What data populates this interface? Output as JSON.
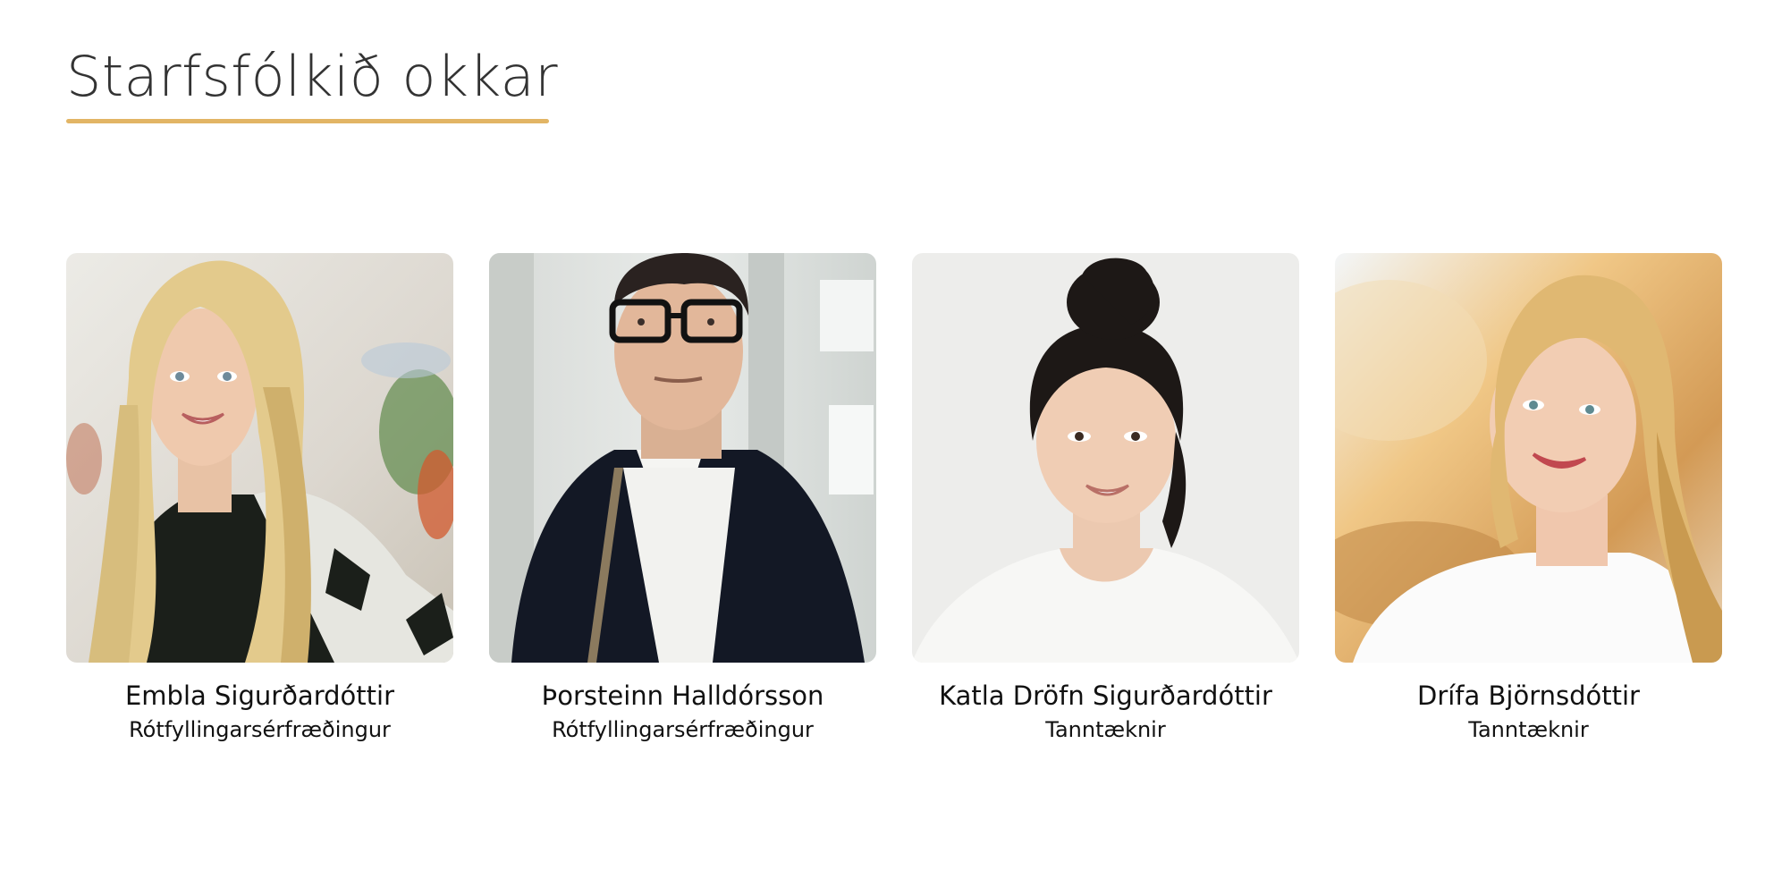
{
  "section": {
    "title": "Starfsfólkið okkar",
    "accent_color": "#E2B565"
  },
  "staff": [
    {
      "name": "Embla Sigurðardóttir",
      "role": "Rótfyllingarsérfræðingur",
      "photo_icon": "portrait-woman-blonde-icon"
    },
    {
      "name": "Þorsteinn Halldórsson",
      "role": "Rótfyllingarsérfræðingur",
      "photo_icon": "portrait-man-glasses-icon"
    },
    {
      "name": "Katla Dröfn Sigurðardóttir",
      "role": "Tanntæknir",
      "photo_icon": "portrait-woman-dark-hair-icon"
    },
    {
      "name": "Drífa Björnsdóttir",
      "role": "Tanntæknir",
      "photo_icon": "portrait-woman-blonde-icon"
    }
  ]
}
